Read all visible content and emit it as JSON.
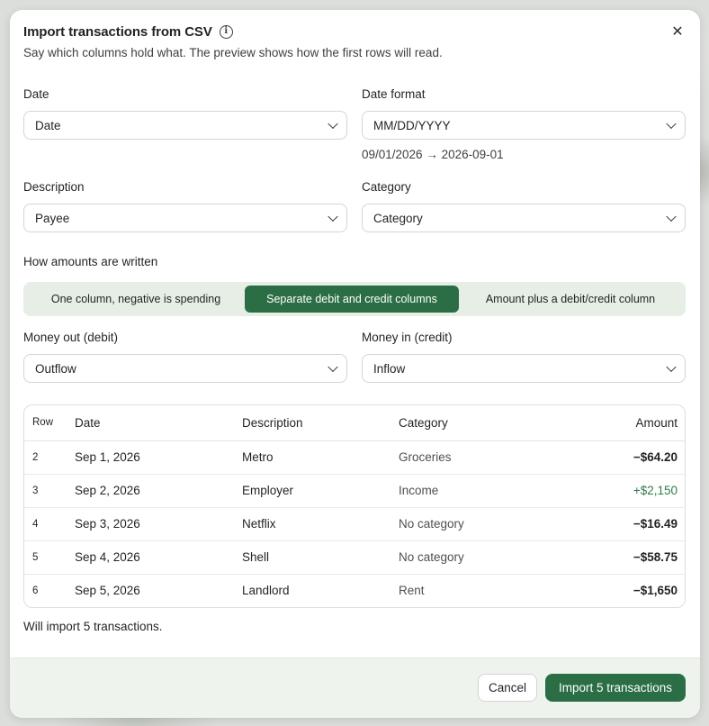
{
  "dialog": {
    "title": "Import transactions from CSV",
    "subtitle": "Say which columns hold what. The preview shows how the first rows will read.",
    "close_label": "✕"
  },
  "fields": {
    "date": {
      "label": "Date",
      "value": "Date"
    },
    "date_format": {
      "label": "Date format",
      "value": "MM/DD/YYYY",
      "example": "09/01/2026 → 2026-09-01"
    },
    "description": {
      "label": "Description",
      "value": "Payee"
    },
    "category": {
      "label": "Category",
      "value": "Category"
    },
    "money_out": {
      "label": "Money out (debit)",
      "value": "Outflow"
    },
    "money_in": {
      "label": "Money in (credit)",
      "value": "Inflow"
    }
  },
  "amounts": {
    "label": "How amounts are written",
    "options": [
      "One column, negative is spending",
      "Separate debit and credit columns",
      "Amount plus a debit/credit column"
    ],
    "selected_index": 1
  },
  "preview": {
    "headers": {
      "row": "Row",
      "date": "Date",
      "description": "Description",
      "category": "Category",
      "amount": "Amount"
    },
    "rows": [
      {
        "row": "2",
        "date": "Sep 1, 2026",
        "description": "Metro",
        "category": "Groceries",
        "amount": "−$64.20"
      },
      {
        "row": "3",
        "date": "Sep 2, 2026",
        "description": "Employer",
        "category": "Income",
        "amount": "+$2,150"
      },
      {
        "row": "4",
        "date": "Sep 3, 2026",
        "description": "Netflix",
        "category": "No category",
        "amount": "−$16.49"
      },
      {
        "row": "5",
        "date": "Sep 4, 2026",
        "description": "Shell",
        "category": "No category",
        "amount": "−$58.75"
      },
      {
        "row": "6",
        "date": "Sep 5, 2026",
        "description": "Landlord",
        "category": "Rent",
        "amount": "−$1,650"
      }
    ]
  },
  "summary": "Will import 5 transactions.",
  "footer": {
    "cancel_label": "Cancel",
    "import_label": "Import 5 transactions"
  },
  "colors": {
    "accent": "#2b6e45",
    "positive_amount": "#2f7a4a",
    "segmented_bg": "#e6eee6",
    "footer_bg": "#eef3ee"
  }
}
